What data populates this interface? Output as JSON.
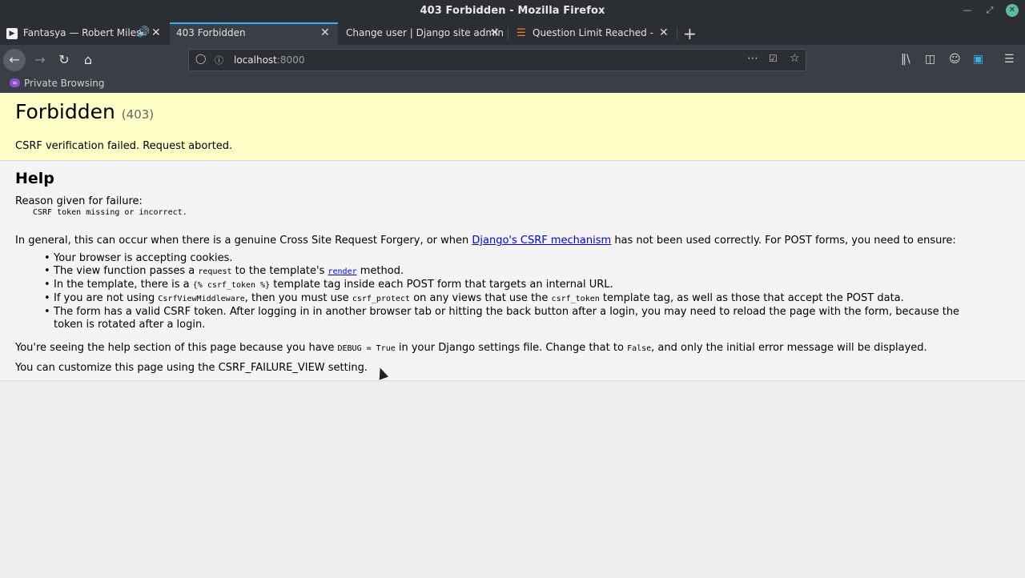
{
  "window": {
    "title": "403 Forbidden - Mozilla Firefox"
  },
  "tabs": [
    {
      "label": "Fantasya — Robert Miles"
    },
    {
      "label": "403 Forbidden"
    },
    {
      "label": "Change user | Django site admin"
    },
    {
      "label": "Question Limit Reached - Sta"
    }
  ],
  "urlbar": {
    "host": "localhost",
    "port": ":8000"
  },
  "private": {
    "label": "Private Browsing"
  },
  "page": {
    "title": "Forbidden",
    "code": "(403)",
    "message": "CSRF verification failed. Request aborted.",
    "help_heading": "Help",
    "reason_label": "Reason given for failure:",
    "reason": "CSRF token missing or incorrect.",
    "general_pre": "In general, this can occur when there is a genuine Cross Site Request Forgery, or when ",
    "general_link": "Django's CSRF mechanism",
    "general_post": " has not been used correctly. For POST forms, you need to ensure:",
    "item1": "Your browser is accepting cookies.",
    "item2_a": "The view function passes a ",
    "item2_code": "request",
    "item2_b": " to the template's ",
    "item2_link": "render",
    "item2_c": " method.",
    "item3_a": "In the template, there is a ",
    "item3_code": "{% csrf_token %}",
    "item3_b": " template tag inside each POST form that targets an internal URL.",
    "item4_a": "If you are not using ",
    "item4_code1": "CsrfViewMiddleware",
    "item4_b": ", then you must use ",
    "item4_code2": "csrf_protect",
    "item4_c": " on any views that use the ",
    "item4_code3": "csrf_token",
    "item4_d": " template tag, as well as those that accept the POST data.",
    "item5": "The form has a valid CSRF token. After logging in in another browser tab or hitting the back button after a login, you may need to reload the page with the form, because the token is rotated after a login.",
    "debug_a": "You're seeing the help section of this page because you have ",
    "debug_code1": "DEBUG = True",
    "debug_b": " in your Django settings file. Change that to ",
    "debug_code2": "False",
    "debug_c": ", and only the initial error message will be displayed.",
    "custom": "You can customize this page using the CSRF_FAILURE_VIEW setting."
  }
}
